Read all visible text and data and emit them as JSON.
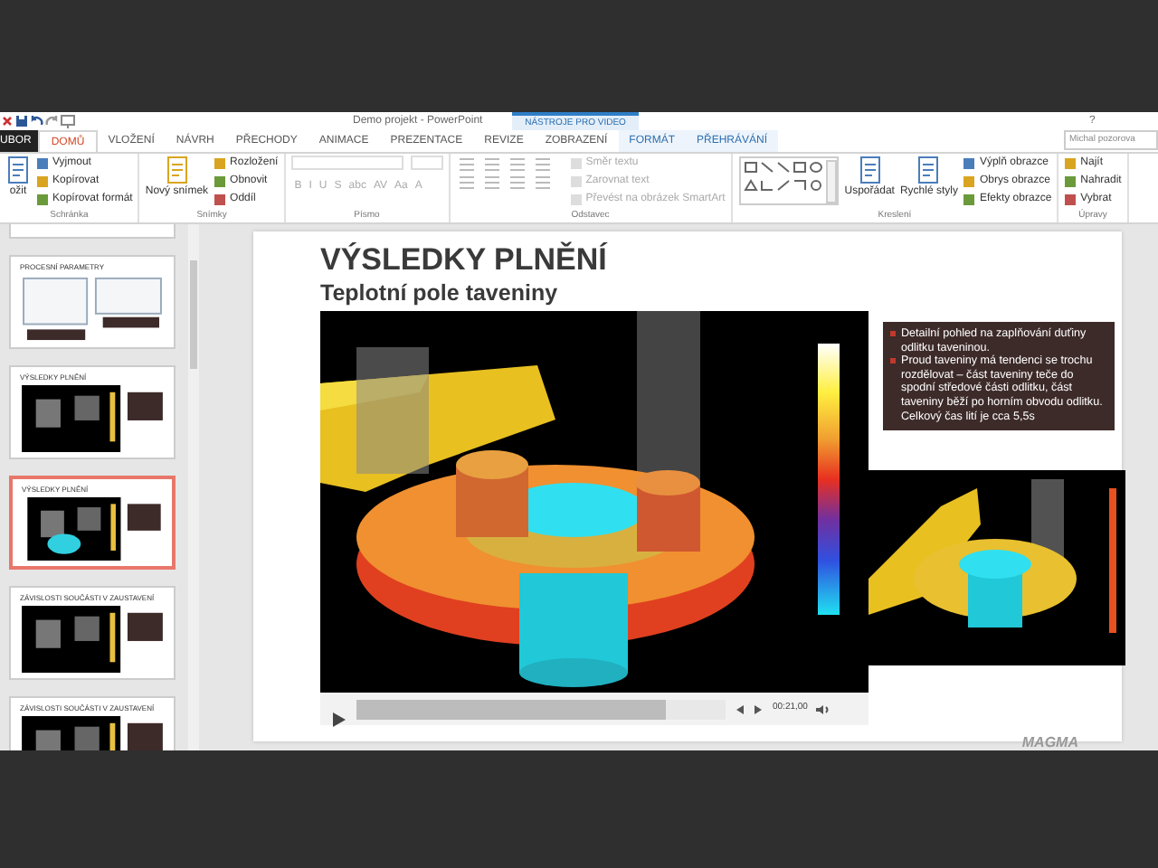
{
  "window": {
    "title": "Demo projekt - PowerPoint",
    "help": "?",
    "user_field": "Michal pozorova"
  },
  "context_tab_group": "NÁSTROJE PRO VIDEO",
  "ribbon_tabs": [
    {
      "label": "UBOR",
      "selected": false,
      "kind": "file"
    },
    {
      "label": "DOMŮ",
      "selected": true,
      "kind": "tab"
    },
    {
      "label": "VLOŽENÍ",
      "selected": false,
      "kind": "tab"
    },
    {
      "label": "NÁVRH",
      "selected": false,
      "kind": "tab"
    },
    {
      "label": "PŘECHODY",
      "selected": false,
      "kind": "tab"
    },
    {
      "label": "ANIMACE",
      "selected": false,
      "kind": "tab"
    },
    {
      "label": "PREZENTACE",
      "selected": false,
      "kind": "tab"
    },
    {
      "label": "REVIZE",
      "selected": false,
      "kind": "tab"
    },
    {
      "label": "ZOBRAZENÍ",
      "selected": false,
      "kind": "tab"
    },
    {
      "label": "FORMÁT",
      "selected": false,
      "kind": "context"
    },
    {
      "label": "PŘEHRÁVÁNÍ",
      "selected": false,
      "kind": "context"
    }
  ],
  "ribbon_groups": [
    {
      "label": "Schránka",
      "disabled": false,
      "columns": [
        [
          {
            "kind": "large",
            "label": "ožit"
          }
        ],
        [
          {
            "kind": "small",
            "label": "Vyjmout"
          },
          {
            "kind": "small",
            "label": "Kopírovat"
          },
          {
            "kind": "small",
            "label": "Kopírovat formát"
          }
        ]
      ]
    },
    {
      "label": "Snímky",
      "disabled": false,
      "columns": [
        [
          {
            "kind": "large",
            "label": "Nový snímek"
          }
        ],
        [
          {
            "kind": "small",
            "label": "Rozložení"
          },
          {
            "kind": "small",
            "label": "Obnovit"
          },
          {
            "kind": "small",
            "label": "Oddíl"
          }
        ]
      ]
    },
    {
      "label": "Písmo",
      "disabled": true,
      "columns": [
        [
          {
            "kind": "fields"
          },
          {
            "kind": "glyphs",
            "glyphs": [
              "B",
              "I",
              "U",
              "S",
              "abc",
              "AV",
              "Aa",
              "A"
            ]
          }
        ]
      ]
    },
    {
      "label": "Odstavec",
      "disabled": true,
      "columns": [
        [
          {
            "kind": "lines"
          },
          {
            "kind": "lines"
          }
        ],
        [
          {
            "kind": "small",
            "label": "Směr textu"
          },
          {
            "kind": "small",
            "label": "Zarovnat text"
          },
          {
            "kind": "small",
            "label": "Převést na obrázek SmartArt"
          }
        ]
      ]
    },
    {
      "label": "Kreslení",
      "disabled": false,
      "columns": [
        [
          {
            "kind": "gallery"
          }
        ],
        [
          {
            "kind": "large",
            "label": "Uspořádat"
          }
        ],
        [
          {
            "kind": "large",
            "label": "Rychlé styly"
          }
        ],
        [
          {
            "kind": "small",
            "label": "Výplň obrazce"
          },
          {
            "kind": "small",
            "label": "Obrys obrazce"
          },
          {
            "kind": "small",
            "label": "Efekty obrazce"
          }
        ]
      ]
    },
    {
      "label": "Úpravy",
      "disabled": false,
      "columns": [
        [
          {
            "kind": "small",
            "label": "Najít"
          },
          {
            "kind": "small",
            "label": "Nahradit"
          },
          {
            "kind": "small",
            "label": "Vybrat"
          }
        ]
      ]
    }
  ],
  "thumbnails": [
    {
      "kind": "cut",
      "selected": false
    },
    {
      "title": "PROCESNÍ PARAMETRY",
      "kind": "forms",
      "selected": false
    },
    {
      "title": "VÝSLEDKY PLNĚNÍ",
      "kind": "render",
      "selected": false
    },
    {
      "title": "VÝSLEDKY PLNĚNÍ",
      "kind": "render",
      "selected": true
    },
    {
      "title": "ZÁVISLOSTI SOUČÁSTI V ZAUSTAVENÍ",
      "kind": "render",
      "selected": false
    },
    {
      "title": "ZÁVISLOSTI SOUČÁSTI V ZAUSTAVENÍ",
      "kind": "render",
      "selected": false
    }
  ],
  "slide": {
    "title": "VÝSLEDKY PLNĚNÍ",
    "subtitle": "Teplotní pole taveniny",
    "bullets": [
      "Detailní pohled na zaplňování duťiny odlitku taveninou.",
      "Proud taveniny má tendenci se trochu rozdělovat – část taveniny teče do spodní středové části odlitku, část taveniny běží po horním obvodu odlitku. Celkový čas lití je cca 5,5s"
    ],
    "player": {
      "level": 0.84,
      "time": "00:21,00"
    },
    "logo": "MAGMA"
  }
}
